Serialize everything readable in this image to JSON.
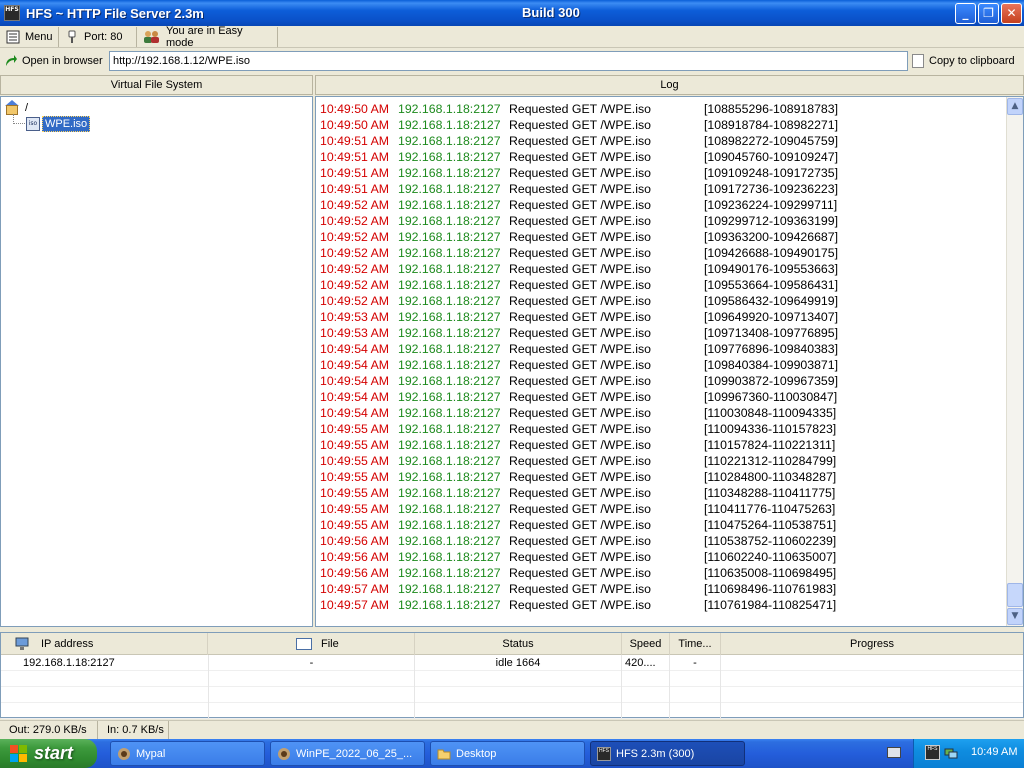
{
  "window": {
    "title": "HFS ~ HTTP File Server 2.3m",
    "build": "Build 300",
    "app_icon_text": "HFS",
    "minimize_glyph": "_",
    "maximize_glyph": "❐",
    "close_glyph": "✕",
    "accent": "#0a50c8"
  },
  "toolbar": {
    "menu_label": "Menu",
    "port_label": "Port: 80",
    "mode_label": "You are in Easy mode"
  },
  "address": {
    "open_label": "Open in browser",
    "url": "http://192.168.1.12/WPE.iso",
    "copy_label": "Copy to clipboard"
  },
  "vfs": {
    "header": "Virtual File System",
    "root_label": "/",
    "file_icon_text": "iso",
    "file_label": "WPE.iso"
  },
  "log": {
    "header": "Log",
    "colors": {
      "time": "#d40000",
      "ip": "#1d8a1d",
      "text": "#000000"
    },
    "rows": [
      {
        "time": "10:49:50 AM",
        "ip": "192.168.1.18:2127",
        "msg": "Requested GET /WPE.iso",
        "range": "[108855296-108918783]"
      },
      {
        "time": "10:49:50 AM",
        "ip": "192.168.1.18:2127",
        "msg": "Requested GET /WPE.iso",
        "range": "[108918784-108982271]"
      },
      {
        "time": "10:49:51 AM",
        "ip": "192.168.1.18:2127",
        "msg": "Requested GET /WPE.iso",
        "range": "[108982272-109045759]"
      },
      {
        "time": "10:49:51 AM",
        "ip": "192.168.1.18:2127",
        "msg": "Requested GET /WPE.iso",
        "range": "[109045760-109109247]"
      },
      {
        "time": "10:49:51 AM",
        "ip": "192.168.1.18:2127",
        "msg": "Requested GET /WPE.iso",
        "range": "[109109248-109172735]"
      },
      {
        "time": "10:49:51 AM",
        "ip": "192.168.1.18:2127",
        "msg": "Requested GET /WPE.iso",
        "range": "[109172736-109236223]"
      },
      {
        "time": "10:49:52 AM",
        "ip": "192.168.1.18:2127",
        "msg": "Requested GET /WPE.iso",
        "range": "[109236224-109299711]"
      },
      {
        "time": "10:49:52 AM",
        "ip": "192.168.1.18:2127",
        "msg": "Requested GET /WPE.iso",
        "range": "[109299712-109363199]"
      },
      {
        "time": "10:49:52 AM",
        "ip": "192.168.1.18:2127",
        "msg": "Requested GET /WPE.iso",
        "range": "[109363200-109426687]"
      },
      {
        "time": "10:49:52 AM",
        "ip": "192.168.1.18:2127",
        "msg": "Requested GET /WPE.iso",
        "range": "[109426688-109490175]"
      },
      {
        "time": "10:49:52 AM",
        "ip": "192.168.1.18:2127",
        "msg": "Requested GET /WPE.iso",
        "range": "[109490176-109553663]"
      },
      {
        "time": "10:49:52 AM",
        "ip": "192.168.1.18:2127",
        "msg": "Requested GET /WPE.iso",
        "range": "[109553664-109586431]"
      },
      {
        "time": "10:49:52 AM",
        "ip": "192.168.1.18:2127",
        "msg": "Requested GET /WPE.iso",
        "range": "[109586432-109649919]"
      },
      {
        "time": "10:49:53 AM",
        "ip": "192.168.1.18:2127",
        "msg": "Requested GET /WPE.iso",
        "range": "[109649920-109713407]"
      },
      {
        "time": "10:49:53 AM",
        "ip": "192.168.1.18:2127",
        "msg": "Requested GET /WPE.iso",
        "range": "[109713408-109776895]"
      },
      {
        "time": "10:49:54 AM",
        "ip": "192.168.1.18:2127",
        "msg": "Requested GET /WPE.iso",
        "range": "[109776896-109840383]"
      },
      {
        "time": "10:49:54 AM",
        "ip": "192.168.1.18:2127",
        "msg": "Requested GET /WPE.iso",
        "range": "[109840384-109903871]"
      },
      {
        "time": "10:49:54 AM",
        "ip": "192.168.1.18:2127",
        "msg": "Requested GET /WPE.iso",
        "range": "[109903872-109967359]"
      },
      {
        "time": "10:49:54 AM",
        "ip": "192.168.1.18:2127",
        "msg": "Requested GET /WPE.iso",
        "range": "[109967360-110030847]"
      },
      {
        "time": "10:49:54 AM",
        "ip": "192.168.1.18:2127",
        "msg": "Requested GET /WPE.iso",
        "range": "[110030848-110094335]"
      },
      {
        "time": "10:49:55 AM",
        "ip": "192.168.1.18:2127",
        "msg": "Requested GET /WPE.iso",
        "range": "[110094336-110157823]"
      },
      {
        "time": "10:49:55 AM",
        "ip": "192.168.1.18:2127",
        "msg": "Requested GET /WPE.iso",
        "range": "[110157824-110221311]"
      },
      {
        "time": "10:49:55 AM",
        "ip": "192.168.1.18:2127",
        "msg": "Requested GET /WPE.iso",
        "range": "[110221312-110284799]"
      },
      {
        "time": "10:49:55 AM",
        "ip": "192.168.1.18:2127",
        "msg": "Requested GET /WPE.iso",
        "range": "[110284800-110348287]"
      },
      {
        "time": "10:49:55 AM",
        "ip": "192.168.1.18:2127",
        "msg": "Requested GET /WPE.iso",
        "range": "[110348288-110411775]"
      },
      {
        "time": "10:49:55 AM",
        "ip": "192.168.1.18:2127",
        "msg": "Requested GET /WPE.iso",
        "range": "[110411776-110475263]"
      },
      {
        "time": "10:49:55 AM",
        "ip": "192.168.1.18:2127",
        "msg": "Requested GET /WPE.iso",
        "range": "[110475264-110538751]"
      },
      {
        "time": "10:49:56 AM",
        "ip": "192.168.1.18:2127",
        "msg": "Requested GET /WPE.iso",
        "range": "[110538752-110602239]"
      },
      {
        "time": "10:49:56 AM",
        "ip": "192.168.1.18:2127",
        "msg": "Requested GET /WPE.iso",
        "range": "[110602240-110635007]"
      },
      {
        "time": "10:49:56 AM",
        "ip": "192.168.1.18:2127",
        "msg": "Requested GET /WPE.iso",
        "range": "[110635008-110698495]"
      },
      {
        "time": "10:49:57 AM",
        "ip": "192.168.1.18:2127",
        "msg": "Requested GET /WPE.iso",
        "range": "[110698496-110761983]"
      },
      {
        "time": "10:49:57 AM",
        "ip": "192.168.1.18:2127",
        "msg": "Requested GET /WPE.iso",
        "range": "[110761984-110825471]"
      }
    ]
  },
  "connections": {
    "columns": [
      "IP address",
      "File",
      "Status",
      "Speed",
      "Time...",
      "Progress"
    ],
    "rows": [
      {
        "ip": "192.168.1.18:2127",
        "file": "-",
        "status": "idle 1664",
        "speed": "420....",
        "time": "-",
        "progress": ""
      }
    ]
  },
  "status": {
    "out": "Out: 279.0 KB/s",
    "in": "In: 0.7 KB/s"
  },
  "taskbar": {
    "start_label": "start",
    "tasks": [
      {
        "label": "Mypal",
        "icon": "mypal-icon",
        "active": false
      },
      {
        "label": "WinPE_2022_06_25_...",
        "icon": "winpe-icon",
        "active": false
      },
      {
        "label": "Desktop",
        "icon": "folder-icon",
        "active": false
      },
      {
        "label": "HFS 2.3m (300)",
        "icon": "hfs-icon",
        "active": true
      }
    ],
    "clock": "10:49 AM",
    "tray_icon_text": "HFS"
  }
}
